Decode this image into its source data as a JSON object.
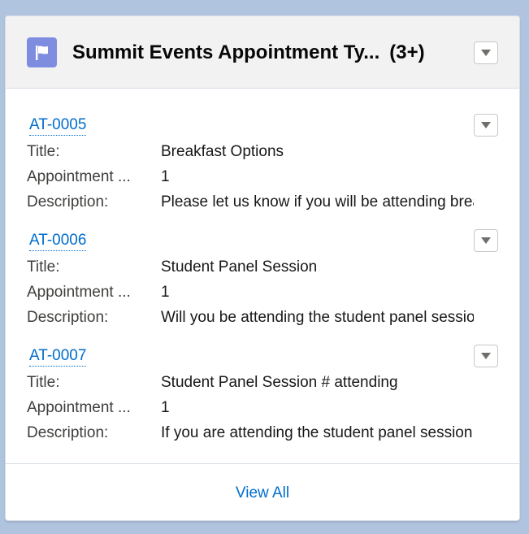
{
  "card": {
    "icon": "flag-icon",
    "title": "Summit Events Appointment Ty...",
    "count": "(3+)",
    "accent_color": "#7f8de1",
    "link_color": "#006dcc"
  },
  "records": [
    {
      "id": "AT-0005",
      "fields": [
        {
          "label": "Title:",
          "value": "Breakfast Options"
        },
        {
          "label": "Appointment ...",
          "value": "1"
        },
        {
          "label": "Description:",
          "value": "Please let us know if you will be attending breakfast"
        }
      ]
    },
    {
      "id": "AT-0006",
      "fields": [
        {
          "label": "Title:",
          "value": "Student Panel Session"
        },
        {
          "label": "Appointment ...",
          "value": "1"
        },
        {
          "label": "Description:",
          "value": "Will you be attending the student panel session"
        }
      ]
    },
    {
      "id": "AT-0007",
      "fields": [
        {
          "label": "Title:",
          "value": "Student Panel Session # attending"
        },
        {
          "label": "Appointment ...",
          "value": "1"
        },
        {
          "label": "Description:",
          "value": "If you are attending the student panel session"
        }
      ]
    }
  ],
  "footer": {
    "view_all": "View All"
  }
}
